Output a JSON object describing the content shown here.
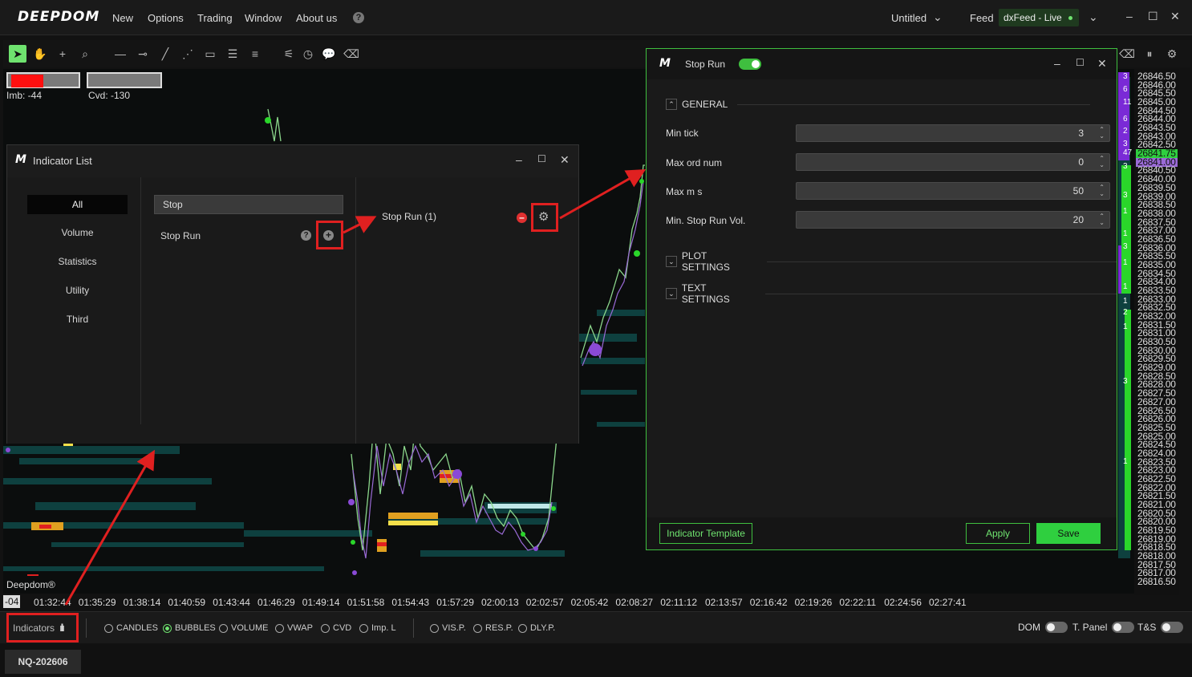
{
  "menubar": {
    "logo": "DEEPDOM",
    "items": [
      "New",
      "Options",
      "Trading",
      "Window",
      "About us"
    ],
    "help_icon": "?",
    "workspace": "Untitled",
    "feed_label": "Feed",
    "feed_value": "dxFeed - Live"
  },
  "chart": {
    "imb": "Imb: -44",
    "cvd": "Cvd: -130",
    "brand": "Deepdom®",
    "time_start": "-04",
    "times": [
      "01:32:44",
      "01:35:29",
      "01:38:14",
      "01:40:59",
      "01:43:44",
      "01:46:29",
      "01:49:14",
      "01:51:58",
      "01:54:43",
      "01:57:29",
      "02:00:13",
      "02:02:57",
      "02:05:42",
      "02:08:27",
      "02:11:12",
      "02:13:57",
      "02:16:42",
      "02:19:26",
      "02:22:11",
      "02:24:56",
      "02:27:41"
    ],
    "prices": [
      "26846.50",
      "26846.00",
      "26845.50",
      "26845.00",
      "26844.50",
      "26844.00",
      "26843.50",
      "26843.00",
      "26842.50",
      "26841.75",
      "26841.00",
      "26840.50",
      "26840.00",
      "26839.50",
      "26839.00",
      "26838.50",
      "26838.00",
      "26837.50",
      "26837.00",
      "26836.50",
      "26836.00",
      "26835.50",
      "26835.00",
      "26834.50",
      "26834.00",
      "26833.50",
      "26833.00",
      "26832.50",
      "26832.00",
      "26831.50",
      "26831.00",
      "26830.50",
      "26830.00",
      "26829.50",
      "26829.00",
      "26828.50",
      "26828.00",
      "26827.50",
      "26827.00",
      "26826.50",
      "26826.00",
      "26825.50",
      "26825.00",
      "26824.50",
      "26824.00",
      "26823.50",
      "26823.00",
      "26822.50",
      "26822.00",
      "26821.50",
      "26821.00",
      "26820.50",
      "26820.00",
      "26819.50",
      "26819.00",
      "26818.50",
      "26818.00",
      "26817.50",
      "26817.00",
      "26816.50"
    ],
    "dom_numbers": [
      "3",
      "6",
      "11",
      "6",
      "2",
      "3",
      "47",
      "3",
      "3",
      "1",
      "1",
      "3",
      "1",
      "1",
      "1",
      "2",
      "1",
      "3",
      "1"
    ]
  },
  "indicator_list": {
    "title": "Indicator List",
    "categories": [
      "All",
      "Volume",
      "Statistics",
      "Utility",
      "Third"
    ],
    "search_value": "Stop",
    "results": [
      {
        "name": "Stop Run"
      }
    ],
    "added": [
      {
        "name": "Stop Run (1)"
      }
    ]
  },
  "stop_run": {
    "title": "Stop Run",
    "general": "GENERAL",
    "fields": [
      {
        "label": "Min tick",
        "value": "3"
      },
      {
        "label": "Max ord num",
        "value": "0"
      },
      {
        "label": "Max m s",
        "value": "50"
      },
      {
        "label": "Min. Stop Run Vol.",
        "value": "20"
      }
    ],
    "plot_settings": "PLOT SETTINGS",
    "text_settings": "TEXT SETTINGS",
    "template_btn": "Indicator Template",
    "apply_btn": "Apply",
    "save_btn": "Save"
  },
  "bottombar": {
    "indicators": "Indicators",
    "radios": [
      {
        "label": "CANDLES",
        "on": false
      },
      {
        "label": "BUBBLES",
        "on": true
      },
      {
        "label": "VOLUME",
        "on": false
      },
      {
        "label": "VWAP",
        "on": false
      },
      {
        "label": "CVD",
        "on": false
      },
      {
        "label": "Imp. L",
        "on": false
      },
      {
        "label": "VIS.P.",
        "on": false
      },
      {
        "label": "RES.P.",
        "on": false
      },
      {
        "label": "DLY.P.",
        "on": false
      }
    ],
    "toggles": [
      "DOM",
      "T. Panel",
      "T&S"
    ]
  },
  "tab": {
    "symbol": "NQ-202606"
  }
}
